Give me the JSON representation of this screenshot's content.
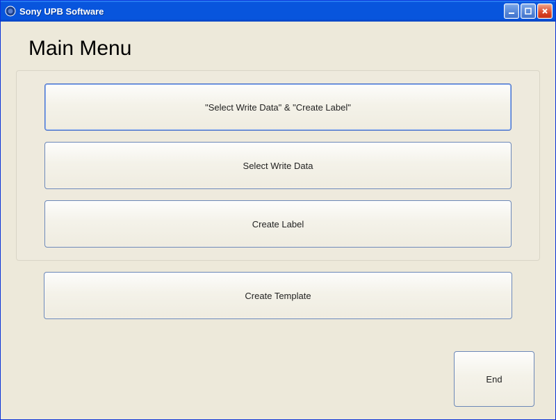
{
  "window": {
    "title": "Sony UPB Software"
  },
  "page": {
    "heading": "Main Menu"
  },
  "buttons": {
    "combined": "\"Select Write Data\" & \"Create Label\"",
    "select_write_data": "Select Write Data",
    "create_label": "Create Label",
    "create_template": "Create Template",
    "end": "End"
  }
}
